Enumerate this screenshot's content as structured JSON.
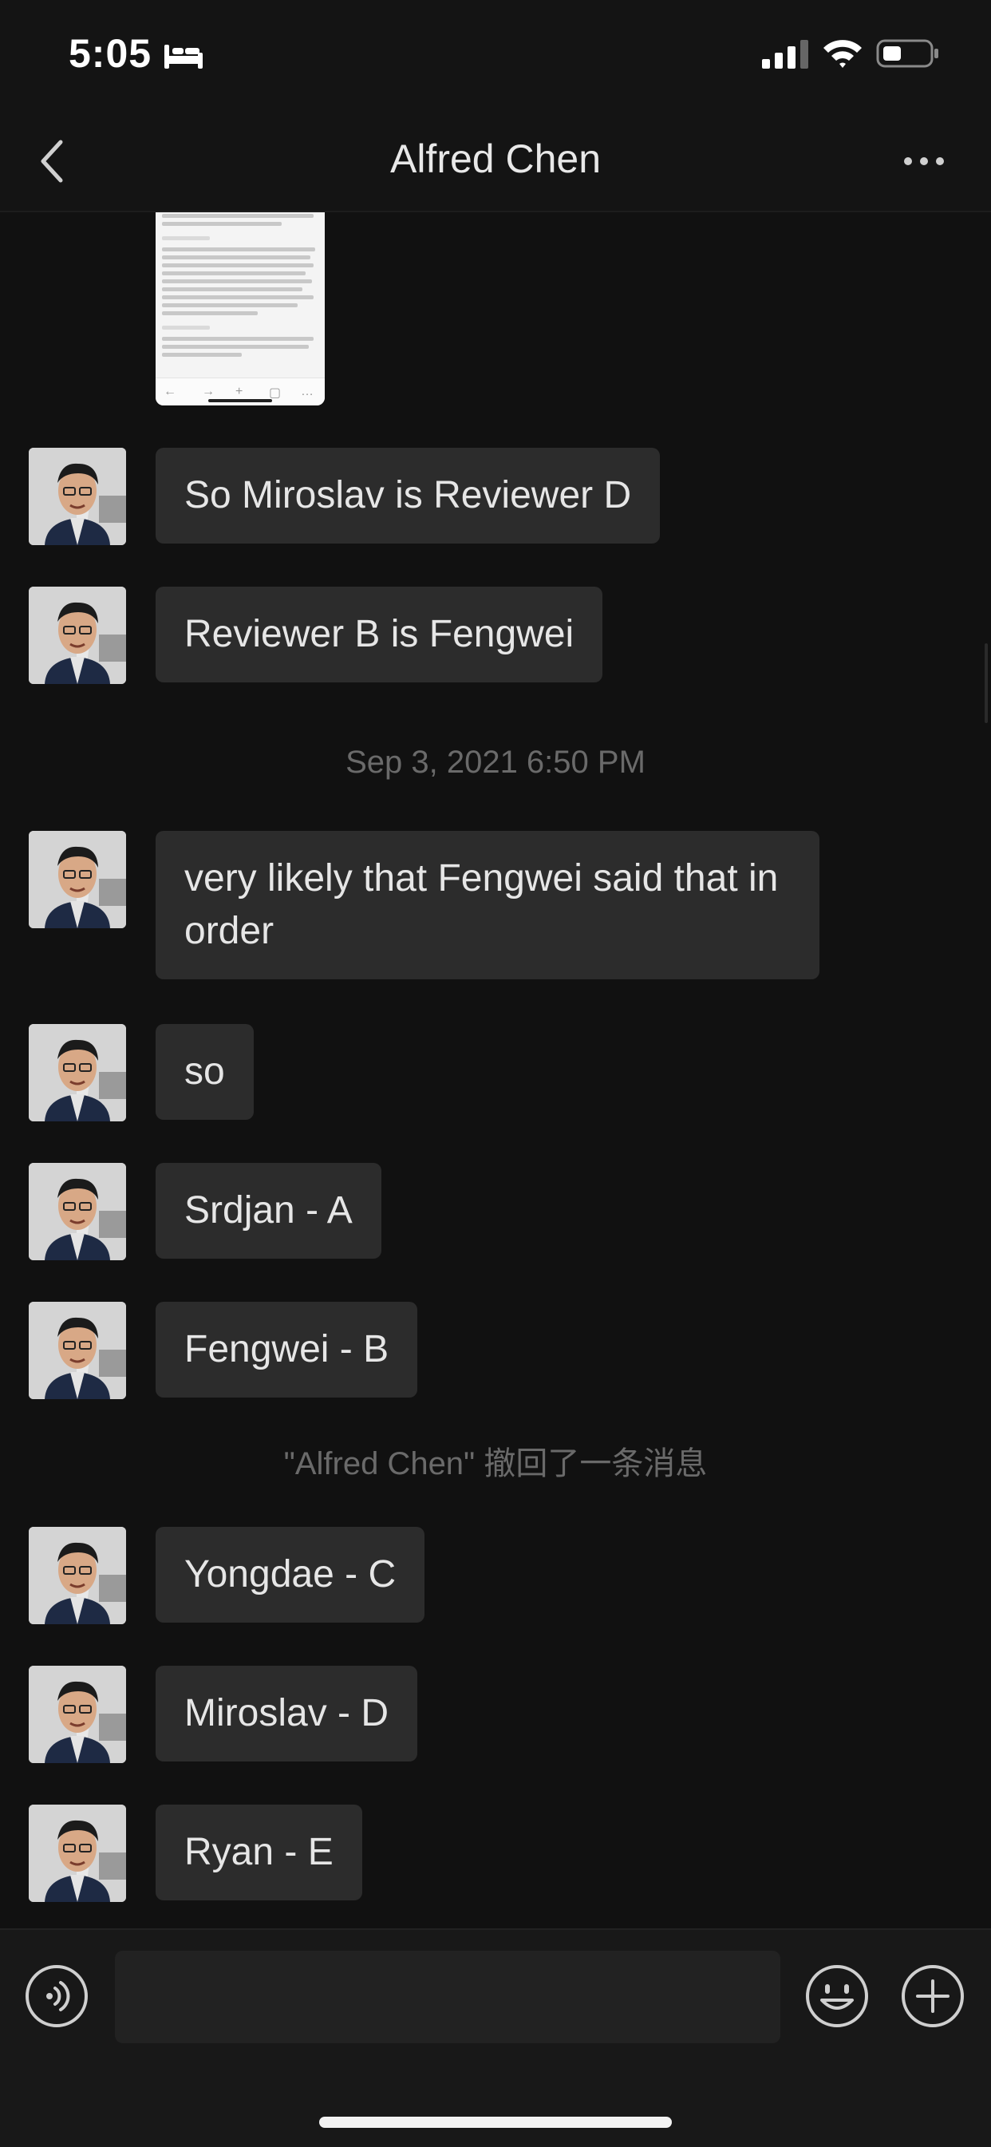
{
  "status_bar": {
    "time": "5:05"
  },
  "header": {
    "title": "Alfred Chen"
  },
  "messages": [
    {
      "text": "So Miroslav is Reviewer D"
    },
    {
      "text": "Reviewer B is Fengwei"
    },
    {
      "text": "very likely that Fengwei said that in order"
    },
    {
      "text": "so"
    },
    {
      "text": "Srdjan - A"
    },
    {
      "text": "Fengwei - B"
    },
    {
      "text": "Yongdae - C"
    },
    {
      "text": "Miroslav - D"
    },
    {
      "text": "Ryan - E"
    }
  ],
  "timestamp": "Sep 3, 2021 6:50 PM",
  "recall_notice": "\"Alfred Chen\" 撤回了一条消息",
  "colors": {
    "background": "#111111",
    "bubble": "#2c2c2c",
    "text": "#e6e6e6",
    "meta_text": "#6a6a6a"
  },
  "icons": [
    "bed-icon",
    "signal-icon",
    "wifi-icon",
    "battery-icon",
    "back-icon",
    "more-icon",
    "voice-icon",
    "emoji-icon",
    "plus-icon"
  ]
}
